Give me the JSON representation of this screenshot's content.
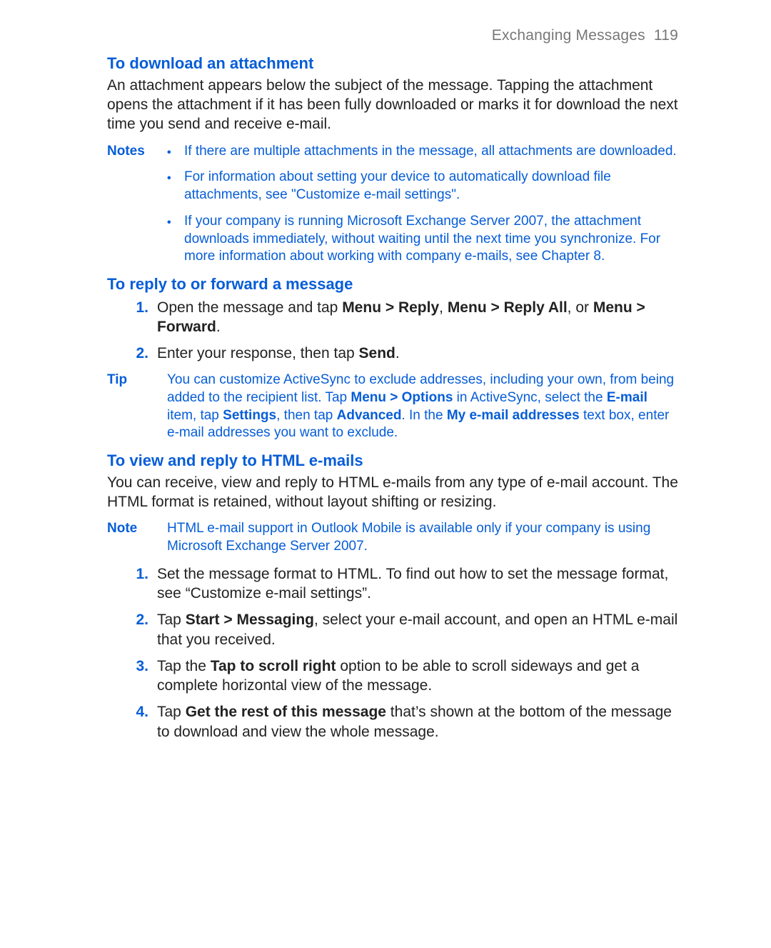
{
  "header": {
    "running": "Exchanging Messages",
    "page": "119"
  },
  "s1": {
    "title": "To download an attachment",
    "para": "An attachment appears below the subject of the message. Tapping the attachment opens the attachment if it has been fully downloaded or marks it for download the next time you send and receive e-mail."
  },
  "notes1": {
    "label": "Notes",
    "b1": "If there are multiple attachments in the message, all attachments are downloaded.",
    "b2": "For information about setting your device to automatically download file attachments, see \"Customize e-mail settings\".",
    "b3": "If your company is running Microsoft Exchange Server 2007, the attachment downloads immediately, without waiting until the next time you synchronize. For more information about working with company e-mails, see Chapter 8."
  },
  "s2": {
    "title": "To reply to or forward a message",
    "step1": {
      "n": "1.",
      "t1": "Open the message and tap ",
      "b1": "Menu > Reply",
      "c1": ", ",
      "b2": "Menu > Reply All",
      "c2": ", or ",
      "b3": "Menu > Forward",
      "c3": "."
    },
    "step2": {
      "n": "2.",
      "t1": "Enter your response, then tap ",
      "b1": "Send",
      "c1": "."
    }
  },
  "tip": {
    "label": "Tip",
    "t1": "You can customize ActiveSync to exclude addresses, including your own, from being added to the recipient list. Tap ",
    "b1": "Menu > Options",
    "t2": " in ActiveSync, select the ",
    "b2": "E-mail",
    "t3": " item, tap ",
    "b3": "Settings",
    "t4": ", then tap ",
    "b4": "Advanced",
    "t5": ". In the ",
    "b5": "My e-mail addresses",
    "t6": " text box, enter e-mail addresses you want to exclude."
  },
  "s3": {
    "title": "To view and reply to HTML e-mails",
    "para": "You can receive, view and reply to HTML e-mails from any type of e-mail account. The HTML format is retained, without layout shifting or resizing."
  },
  "note2": {
    "label": "Note",
    "body": "HTML e-mail support in Outlook Mobile is available only if your company is using Microsoft Exchange Server 2007."
  },
  "s3steps": {
    "n1": "1.",
    "t1": "Set the message format to HTML. To find out how to set the message format, see “Customize e-mail settings”.",
    "n2": "2.",
    "t2a": "Tap ",
    "t2b": "Start > Messaging",
    "t2c": ", select your e-mail account, and open an HTML e-mail that you received.",
    "n3": "3.",
    "t3a": "Tap the ",
    "t3b": "Tap to scroll right",
    "t3c": " option to be able to scroll sideways and get a complete horizontal view of the message.",
    "n4": "4.",
    "t4a": "Tap ",
    "t4b": "Get the rest of this message",
    "t4c": " that’s shown at the bottom of the message to download and view the whole message."
  }
}
